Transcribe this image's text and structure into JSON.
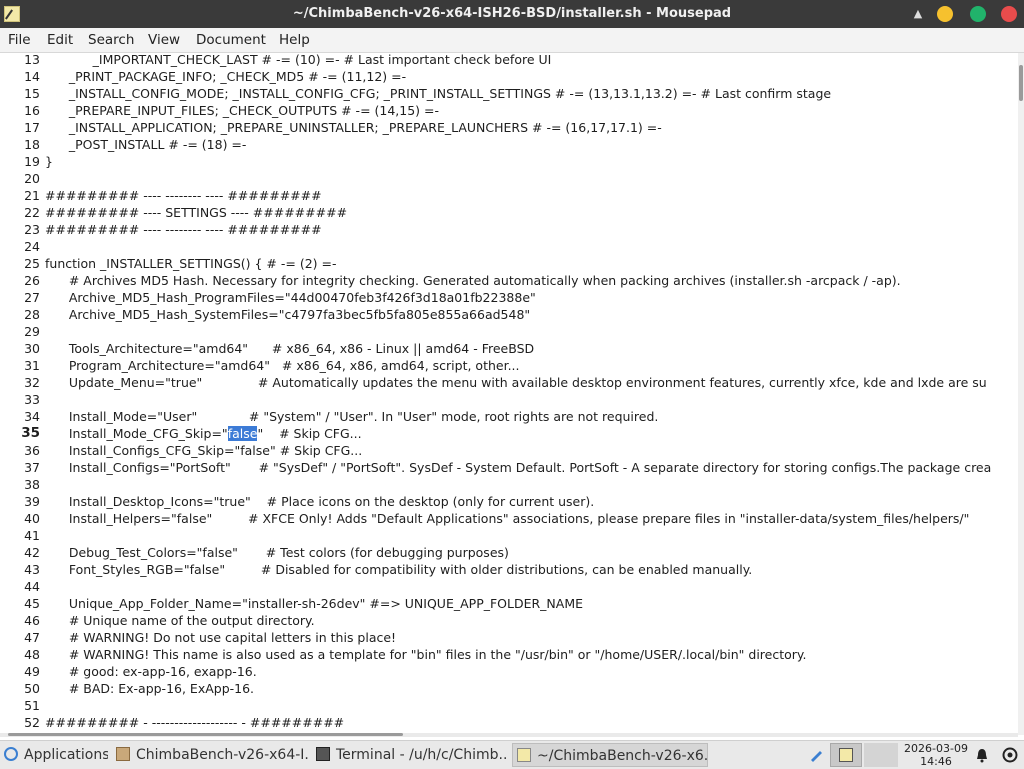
{
  "window": {
    "title": "~/ChimbaBench-v26-x64-ISH26-BSD/installer.sh - Mousepad"
  },
  "menu": [
    "File",
    "Edit",
    "Search",
    "View",
    "Document",
    "Help"
  ],
  "editor": {
    "current_line": 35,
    "lines": [
      {
        "n": "13",
        "text": "            _IMPORTANT_CHECK_LAST # -= (10) =- # Last important check before UI"
      },
      {
        "n": "14",
        "text": "      _PRINT_PACKAGE_INFO; _CHECK_MD5 # -= (11,12) =-"
      },
      {
        "n": "15",
        "text": "      _INSTALL_CONFIG_MODE; _INSTALL_CONFIG_CFG; _PRINT_INSTALL_SETTINGS # -= (13,13.1,13.2) =- # Last confirm stage"
      },
      {
        "n": "16",
        "text": "      _PREPARE_INPUT_FILES; _CHECK_OUTPUTS # -= (14,15) =-"
      },
      {
        "n": "17",
        "text": "      _INSTALL_APPLICATION; _PREPARE_UNINSTALLER; _PREPARE_LAUNCHERS # -= (16,17,17.1) =-"
      },
      {
        "n": "18",
        "text": "      _POST_INSTALL # -= (18) =-"
      },
      {
        "n": "19",
        "text": "}"
      },
      {
        "n": "20",
        "text": ""
      },
      {
        "n": "21",
        "text": "######### ---- -------- ---- #########"
      },
      {
        "n": "22",
        "text": "######### ---- SETTINGS ---- #########"
      },
      {
        "n": "23",
        "text": "######### ---- -------- ---- #########"
      },
      {
        "n": "24",
        "text": ""
      },
      {
        "n": "25",
        "text": "function _INSTALLER_SETTINGS() { # -= (2) =-"
      },
      {
        "n": "26",
        "text": "      # Archives MD5 Hash. Necessary for integrity checking. Generated automatically when packing archives (installer.sh -arcpack / -ap)."
      },
      {
        "n": "27",
        "text": "      Archive_MD5_Hash_ProgramFiles=\"44d00470feb3f426f3d18a01fb22388e\""
      },
      {
        "n": "28",
        "text": "      Archive_MD5_Hash_SystemFiles=\"c4797fa3bec5fb5fa805e855a66ad548\""
      },
      {
        "n": "29",
        "text": ""
      },
      {
        "n": "30",
        "text": "      Tools_Architecture=\"amd64\"      # x86_64, x86 - Linux || amd64 - FreeBSD"
      },
      {
        "n": "31",
        "text": "      Program_Architecture=\"amd64\"   # x86_64, x86, amd64, script, other..."
      },
      {
        "n": "32",
        "text": "      Update_Menu=\"true\"              # Automatically updates the menu with available desktop environment features, currently xfce, kde and lxde are su"
      },
      {
        "n": "33",
        "text": ""
      },
      {
        "n": "34",
        "text": "      Install_Mode=\"User\"             # \"System\" / \"User\". In \"User\" mode, root rights are not required."
      },
      {
        "n": "35",
        "text_before": "      Install_Mode_CFG_Skip=\"",
        "selected": "false",
        "text_after": "\"    # Skip CFG..."
      },
      {
        "n": "36",
        "text": "      Install_Configs_CFG_Skip=\"false\" # Skip CFG..."
      },
      {
        "n": "37",
        "text": "      Install_Configs=\"PortSoft\"       # \"SysDef\" / \"PortSoft\". SysDef - System Default. PortSoft - A separate directory for storing configs.The package crea"
      },
      {
        "n": "38",
        "text": ""
      },
      {
        "n": "39",
        "text": "      Install_Desktop_Icons=\"true\"    # Place icons on the desktop (only for current user)."
      },
      {
        "n": "40",
        "text": "      Install_Helpers=\"false\"         # XFCE Only! Adds \"Default Applications\" associations, please prepare files in \"installer-data/system_files/helpers/\""
      },
      {
        "n": "41",
        "text": ""
      },
      {
        "n": "42",
        "text": "      Debug_Test_Colors=\"false\"       # Test colors (for debugging purposes)"
      },
      {
        "n": "43",
        "text": "      Font_Styles_RGB=\"false\"         # Disabled for compatibility with older distributions, can be enabled manually."
      },
      {
        "n": "44",
        "text": ""
      },
      {
        "n": "45",
        "text": "      Unique_App_Folder_Name=\"installer-sh-26dev\" #=> UNIQUE_APP_FOLDER_NAME"
      },
      {
        "n": "46",
        "text": "      # Unique name of the output directory."
      },
      {
        "n": "47",
        "text": "      # WARNING! Do not use capital letters in this place!"
      },
      {
        "n": "48",
        "text": "      # WARNING! This name is also used as a template for \"bin\" files in the \"/usr/bin\" or \"/home/USER/.local/bin\" directory."
      },
      {
        "n": "49",
        "text": "      # good: ex-app-16, exapp-16."
      },
      {
        "n": "50",
        "text": "      # BAD: Ex-app-16, ExApp-16."
      },
      {
        "n": "51",
        "text": ""
      },
      {
        "n": "52",
        "text": "######### - ------------------- - #########"
      }
    ]
  },
  "taskbar": {
    "applications": "Applications",
    "tasks": [
      {
        "label": "ChimbaBench-v26-x64-I...",
        "icon": "folder-icon"
      },
      {
        "label": "Terminal - /u/h/c/Chimb...",
        "icon": "terminal-icon"
      },
      {
        "label": "~/ChimbaBench-v26-x6...",
        "icon": "mousepad-icon"
      }
    ],
    "clock_date": "2026-03-09",
    "clock_time": "14:46"
  },
  "colors": {
    "titlebar": "#3a3a3a",
    "selection": "#3c7bd6",
    "minimize": "#f6c12e",
    "maximize": "#21b36b",
    "close": "#e84c4c"
  }
}
